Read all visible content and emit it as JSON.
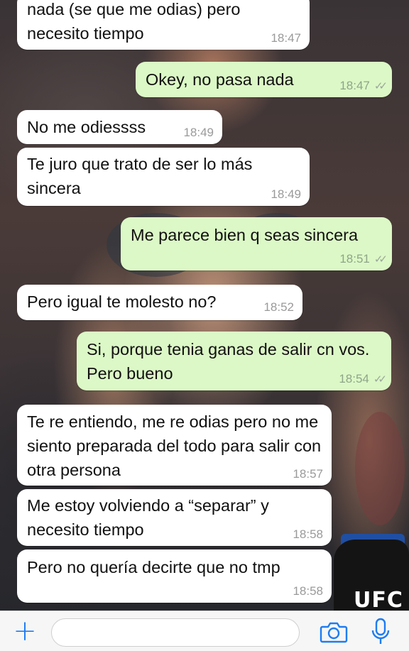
{
  "colors": {
    "incoming_bubble": "#ffffff",
    "outgoing_bubble": "#dcf8c6",
    "accent_blue": "#1d7cf2",
    "timestamp": "#9a9a9a"
  },
  "wallpaper": {
    "glove_text": "UFC"
  },
  "messages": [
    {
      "direction": "incoming",
      "text": "nada (se que me odias) pero necesito tiempo",
      "time": "18:47"
    },
    {
      "direction": "outgoing",
      "text": "Okey, no pasa nada",
      "time": "18:47",
      "status": "read-double-check"
    },
    {
      "direction": "incoming",
      "text": "No me odiessss",
      "time": "18:49"
    },
    {
      "direction": "incoming",
      "text": "Te juro que trato de ser lo más sincera",
      "time": "18:49"
    },
    {
      "direction": "outgoing",
      "text": "Me parece bien q seas sincera",
      "time": "18:51",
      "status": "read-double-check"
    },
    {
      "direction": "incoming",
      "text": "Pero igual te molesto no?",
      "time": "18:52"
    },
    {
      "direction": "outgoing",
      "text": "Si, porque tenia ganas de salir cn vos. Pero bueno",
      "time": "18:54",
      "status": "read-double-check"
    },
    {
      "direction": "incoming",
      "text": "Te re entiendo, me re odias pero no me siento preparada del todo para salir con otra persona",
      "time": "18:57"
    },
    {
      "direction": "incoming",
      "text": "Me estoy volviendo a “separar” y necesito tiempo",
      "time": "18:58"
    },
    {
      "direction": "incoming",
      "text": "Pero no quería decirte que no tmp",
      "time": "18:58"
    }
  ],
  "input_bar": {
    "attach_icon": "plus-icon",
    "message_value": "",
    "camera_icon": "camera-icon",
    "mic_icon": "microphone-icon"
  }
}
